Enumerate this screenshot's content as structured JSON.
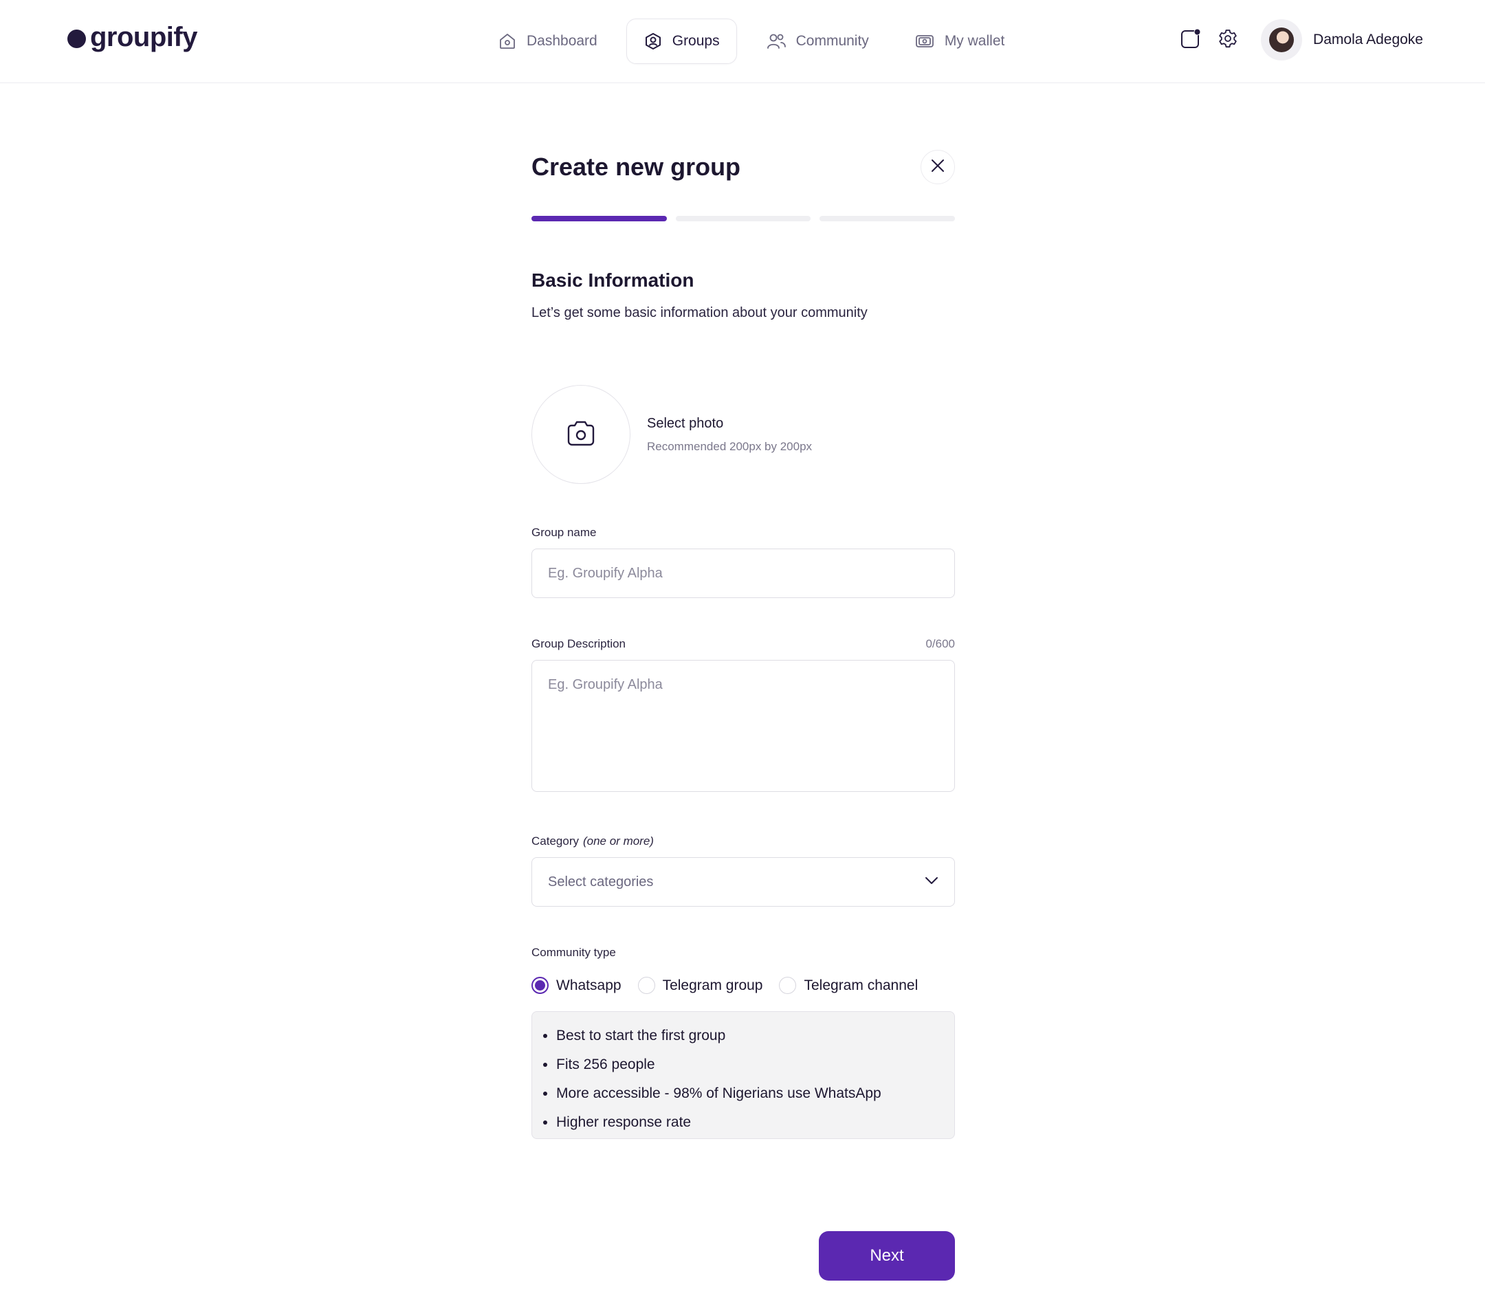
{
  "app": {
    "logo_text": "groupify"
  },
  "nav": {
    "items": [
      {
        "label": "Dashboard",
        "icon": "home-icon",
        "active": false
      },
      {
        "label": "Groups",
        "icon": "groups-icon",
        "active": true
      },
      {
        "label": "Community",
        "icon": "community-icon",
        "active": false
      },
      {
        "label": "My wallet",
        "icon": "wallet-icon",
        "active": false
      }
    ]
  },
  "user": {
    "name": "Damola Adegoke"
  },
  "form": {
    "title": "Create new group",
    "progress": {
      "current_step": 1,
      "total_steps": 3
    },
    "section_title": "Basic Information",
    "section_subtitle": "Let’s get some basic information about your community",
    "photo": {
      "label": "Select photo",
      "hint": "Recommended 200px by 200px"
    },
    "group_name": {
      "label": "Group name",
      "placeholder": "Eg. Groupify Alpha",
      "value": ""
    },
    "group_description": {
      "label": "Group Description",
      "placeholder": "Eg. Groupify Alpha",
      "value": "",
      "counter": "0/600"
    },
    "category": {
      "label": "Category",
      "label_note": "(one or more)",
      "placeholder": "Select categories"
    },
    "community_type": {
      "label": "Community type",
      "options": [
        "Whatsapp",
        "Telegram group",
        "Telegram channel"
      ],
      "selected": "Whatsapp",
      "info": [
        "Best to start the first group",
        "Fits 256 people",
        "More accessible - 98% of Nigerians use WhatsApp",
        "Higher response rate"
      ]
    },
    "next_label": "Next"
  },
  "colors": {
    "accent": "#5b28b1",
    "text": "#1d1730",
    "muted": "#6b6880"
  }
}
